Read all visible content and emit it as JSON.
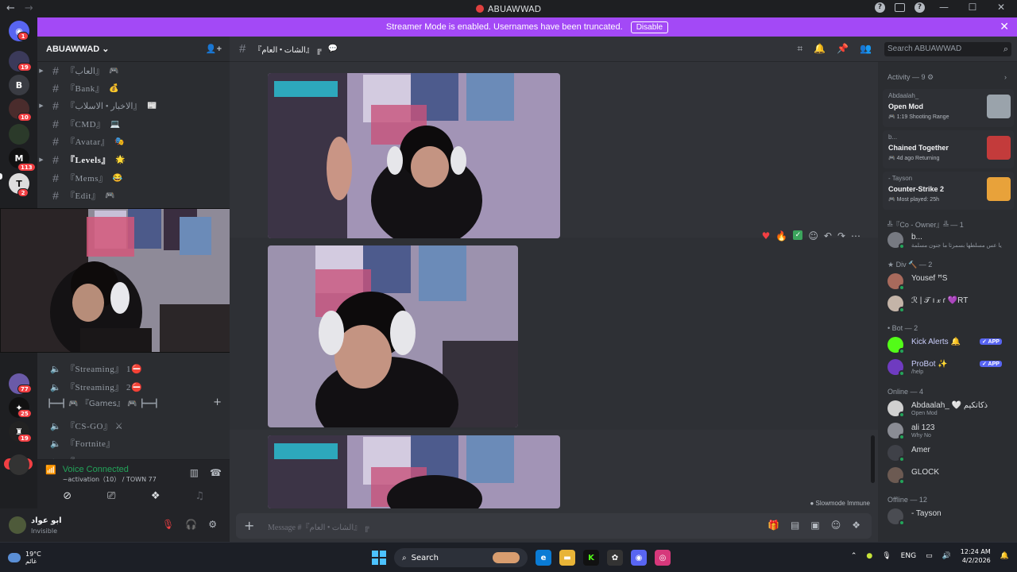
{
  "window": {
    "title": "ABUAWWAD"
  },
  "banner": {
    "text": "Streamer Mode is enabled. Usernames have been truncated.",
    "button": "Disable"
  },
  "server": {
    "name": "ABUAWWAD"
  },
  "guild_badges": [
    "1",
    "19",
    "10",
    "113",
    "2",
    "77",
    "25",
    "19"
  ],
  "guild_letter": "B",
  "new_badge": "NEW",
  "channels": [
    {
      "name": "『العاب』",
      "emoji": "🎮",
      "type": "text",
      "arrow": true
    },
    {
      "name": "『Bank』",
      "emoji": "💰",
      "type": "text",
      "arrow": false
    },
    {
      "name": "『الاخبار • الاسلاب』",
      "emoji": "📰",
      "type": "text",
      "arrow": true
    },
    {
      "name": "『CMD』",
      "emoji": "💻",
      "type": "text",
      "arrow": false
    },
    {
      "name": "『Avatar』",
      "emoji": "🎭",
      "type": "text",
      "arrow": false
    },
    {
      "name": "『Levels』",
      "emoji": "🌟",
      "type": "text",
      "arrow": true,
      "bold": true
    },
    {
      "name": "『Mems』",
      "emoji": "😂",
      "type": "text",
      "arrow": false
    },
    {
      "name": "『Edit』",
      "emoji": "🎮",
      "type": "text",
      "arrow": false
    }
  ],
  "voice_channels": [
    {
      "name": "『Streaming』 1⛔"
    },
    {
      "name": "『Streaming』 2⛔"
    }
  ],
  "games_category": {
    "label": "┣━━┫ 🎮 『Games』 🎮 ┣━━┫",
    "plus": "+"
  },
  "games_channels": [
    {
      "name": "『CS-GO』 ⚔"
    },
    {
      "name": "『Fortnite』"
    },
    {
      "name": "『FiveM』"
    }
  ],
  "voice": {
    "status": "Voice Connected",
    "channel": "~activation（10） / TOWN 77"
  },
  "user": {
    "name": "ابو عواد",
    "status": "Invisible"
  },
  "chat_header": {
    "channel": "『الشات • العام』 ╔"
  },
  "search": {
    "placeholder": "Search ABUAWWAD"
  },
  "composer": {
    "placeholder": "Message #『الشات • العام』 ╔"
  },
  "slowmode": "Slowmode Immune",
  "activity": {
    "title": "Activity — 9",
    "items": [
      {
        "who": "Abdaalah_",
        "game": "Open Mod",
        "meta_time": "1:19",
        "meta_extra": "Shooting Range",
        "art_color": "#9aa3ab"
      },
      {
        "who": "b...",
        "game": "Chained Together",
        "meta_time": "4d ago",
        "meta_extra": "Returning",
        "art_color": "#c33b3b"
      },
      {
        "who": "- Tayson",
        "game": "Counter-Strike 2",
        "meta_time": "",
        "meta_extra": "Most played: 25h",
        "art_color": "#e8a23a"
      }
    ]
  },
  "member_groups": [
    {
      "title": "╩『Co - Owner』╩ — 1",
      "members": [
        {
          "name": "b...",
          "sub": "يا عس مسلطها بسمرتا ما جنون مسلمة",
          "av": "#777a82"
        }
      ]
    },
    {
      "title": "★ Div 🔨 — 2",
      "members": [
        {
          "name": "Yousef ꟸS",
          "sub": "",
          "av": "#a86a5c"
        },
        {
          "name": "ℛ | 𝒯 ı 𝓍 ɾ 💜RT",
          "sub": "",
          "av": "#c4b4a8"
        }
      ]
    },
    {
      "title": "• Bot — 2",
      "members": [
        {
          "name": "Kick Alerts 🔔",
          "sub": "",
          "av": "#53fc18",
          "app": "✓ APP"
        },
        {
          "name": "ProBot ✨",
          "sub": "/help",
          "av": "#6f3bc0",
          "app": "✓ APP"
        }
      ]
    },
    {
      "title": "Online — 4",
      "members": [
        {
          "name": "Abdaalah_ 🤍 ذكاتكيم",
          "sub": "Open Mod",
          "av": "#d0d0d0"
        },
        {
          "name": "ali 123",
          "sub": "Why No",
          "av": "#8a8c94"
        },
        {
          "name": "Amer",
          "sub": "",
          "av": "#3f4148"
        },
        {
          "name": "GLOCK",
          "sub": "",
          "av": "#6c5a52"
        }
      ]
    },
    {
      "title": "Offline — 12",
      "members": [
        {
          "name": "- Tayson",
          "sub": "",
          "av": "#4a4c52"
        }
      ]
    }
  ],
  "taskbar": {
    "temp": "19°C",
    "condition": "غائم",
    "search": "Search",
    "lang": "ENG",
    "time": "12:24 AM",
    "date": "4/2/2026"
  }
}
